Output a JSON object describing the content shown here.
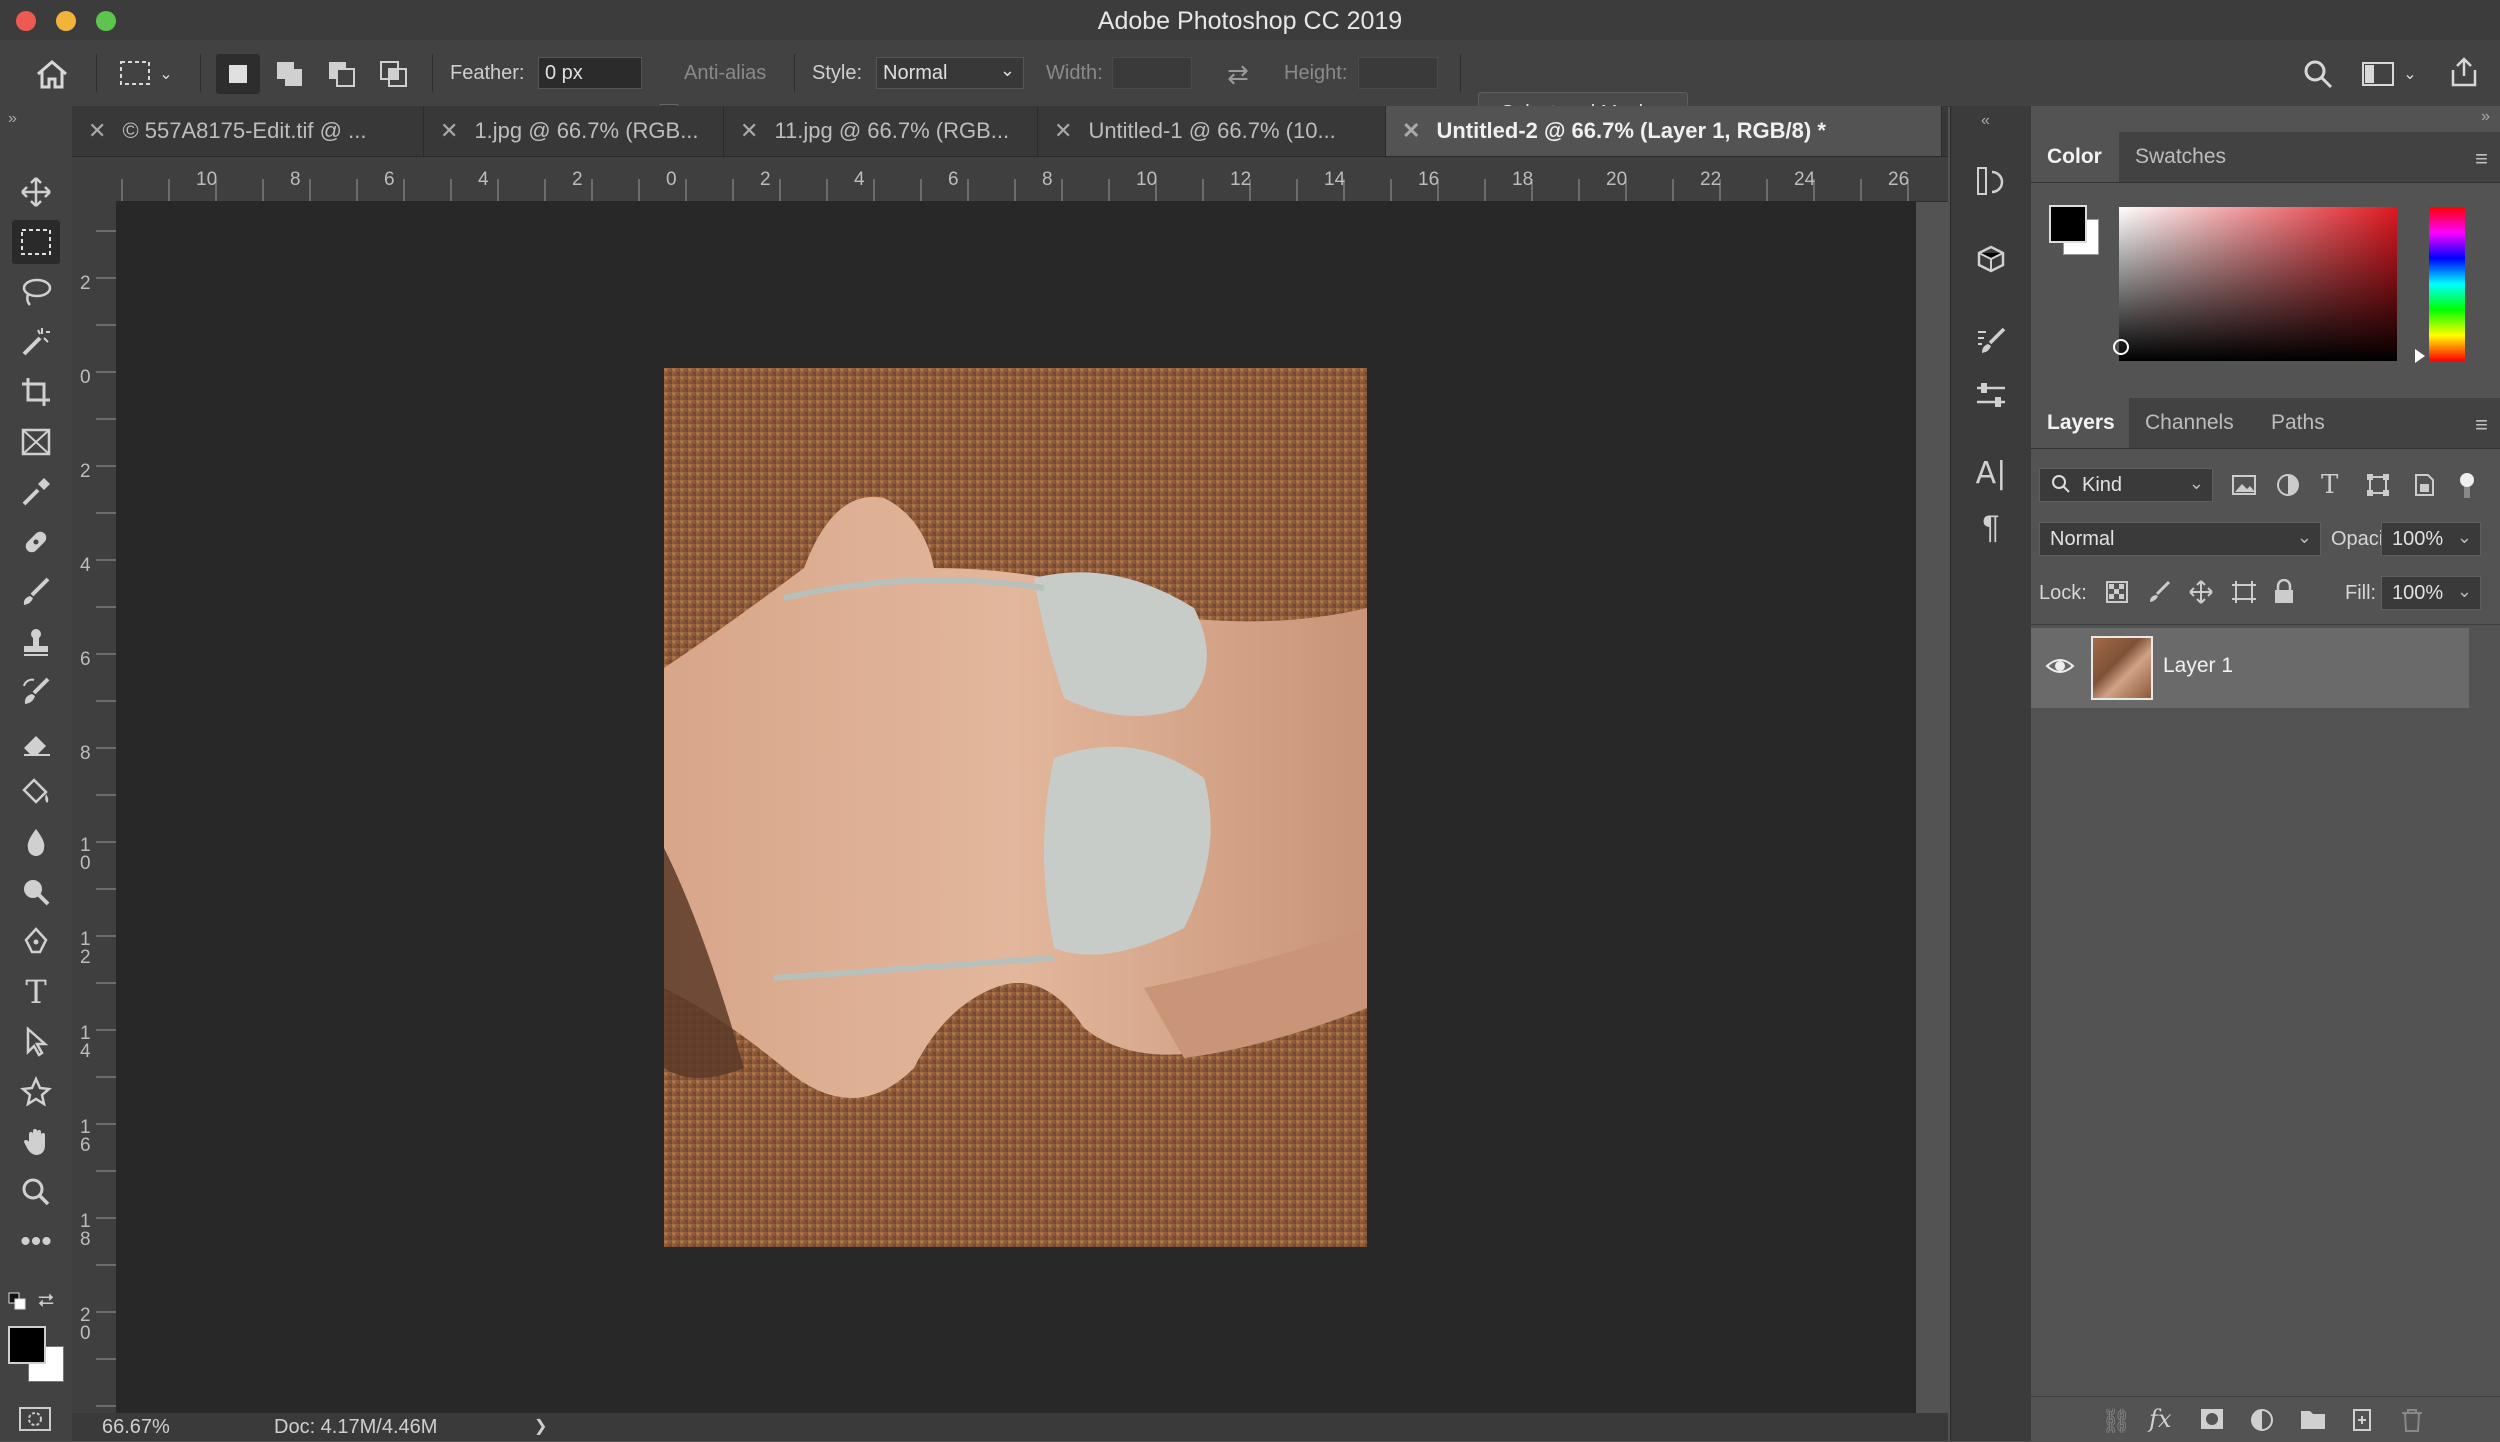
{
  "window": {
    "title": "Adobe Photoshop CC 2019"
  },
  "options_bar": {
    "feather_label": "Feather:",
    "feather_value": "0 px",
    "anti_alias_label": "Anti-alias",
    "style_label": "Style:",
    "style_value": "Normal",
    "width_label": "Width:",
    "height_label": "Height:",
    "select_mask_label": "Select and Mask..."
  },
  "tabs": [
    {
      "label": "© 557A8175-Edit.tif @ ..."
    },
    {
      "label": "1.jpg @ 66.7% (RGB..."
    },
    {
      "label": "11.jpg @ 66.7% (RGB..."
    },
    {
      "label": "Untitled-1 @ 66.7% (10..."
    },
    {
      "label": "Untitled-2 @ 66.7% (Layer 1, RGB/8) *"
    }
  ],
  "ruler_top": [
    "10",
    "8",
    "6",
    "4",
    "2",
    "0",
    "2",
    "4",
    "6",
    "8",
    "10",
    "12",
    "14",
    "16",
    "18",
    "20",
    "22",
    "24",
    "26"
  ],
  "ruler_left": [
    "2",
    "0",
    "2",
    "4",
    "6",
    "8",
    "1\n0",
    "1\n2",
    "1\n4",
    "1\n6",
    "1\n8",
    "2\n0"
  ],
  "status": {
    "zoom": "66.67%",
    "doc": "Doc: 4.17M/4.46M",
    "arrow": "❯"
  },
  "color_panel": {
    "tab_color": "Color",
    "tab_swatches": "Swatches"
  },
  "layers_panel": {
    "tab_layers": "Layers",
    "tab_channels": "Channels",
    "tab_paths": "Paths",
    "filter_kind": "Kind",
    "blend_mode": "Normal",
    "opacity_label": "Opacity:",
    "opacity_value": "100%",
    "lock_label": "Lock:",
    "fill_label": "Fill:",
    "fill_value": "100%",
    "layers": [
      {
        "name": "Layer 1",
        "visible": true
      }
    ]
  },
  "colors": {
    "accent": "#424242",
    "canvas": "#282828",
    "foreground": "#000000",
    "background": "#ffffff"
  }
}
